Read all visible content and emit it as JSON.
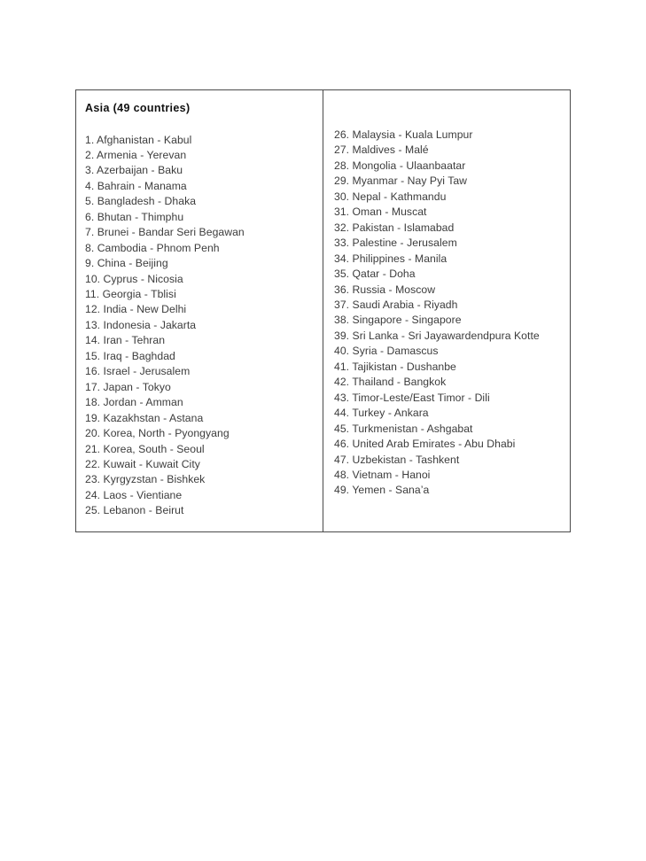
{
  "document": {
    "background_color": "#ffffff",
    "table_border_color": "#4a4a4a",
    "text_color": "#3c3c3c",
    "heading_color": "#111111"
  },
  "table": {
    "heading": "Asia (49 countries)",
    "left_column": [
      {
        "number": "1.",
        "text": "Afghanistan - Kabul"
      },
      {
        "number": "2.",
        "text": "Armenia - Yerevan"
      },
      {
        "number": "3.",
        "text": "Azerbaijan - Baku"
      },
      {
        "number": "4.",
        "text": "Bahrain - Manama"
      },
      {
        "number": "5.",
        "text": "Bangladesh - Dhaka"
      },
      {
        "number": "6.",
        "text": "Bhutan - Thimphu"
      },
      {
        "number": "7.",
        "text": "Brunei - Bandar Seri Begawan"
      },
      {
        "number": "8.",
        "text": "Cambodia - Phnom Penh"
      },
      {
        "number": "9.",
        "text": "China - Beijing"
      },
      {
        "number": "10.",
        "text": "Cyprus - Nicosia"
      },
      {
        "number": "11.",
        "text": "Georgia -  Tblisi"
      },
      {
        "number": "12.",
        "text": "India - New Delhi"
      },
      {
        "number": "13.",
        "text": "Indonesia - Jakarta"
      },
      {
        "number": "14.",
        "text": "Iran - Tehran"
      },
      {
        "number": "15.",
        "text": "Iraq - Baghdad"
      },
      {
        "number": "16.",
        "text": "Israel - Jerusalem"
      },
      {
        "number": "17.",
        "text": "Japan - Tokyo"
      },
      {
        "number": "18.",
        "text": "Jordan - Amman"
      },
      {
        "number": "19.",
        "text": "Kazakhstan - Astana"
      },
      {
        "number": "20.",
        "text": "Korea, North - Pyongyang"
      },
      {
        "number": "21.",
        "text": "Korea, South - Seoul"
      },
      {
        "number": "22.",
        "text": "Kuwait - Kuwait City"
      },
      {
        "number": "23.",
        "text": "Kyrgyzstan - Bishkek"
      },
      {
        "number": "24.",
        "text": "Laos - Vientiane"
      },
      {
        "number": "25.",
        "text": "Lebanon - Beirut"
      }
    ],
    "right_column": [
      {
        "number": "26.",
        "text": "Malaysia - Kuala Lumpur"
      },
      {
        "number": "27.",
        "text": "Maldives - Malé"
      },
      {
        "number": "28.",
        "text": "Mongolia - Ulaanbaatar"
      },
      {
        "number": "29.",
        "text": "Myanmar - Nay Pyi Taw"
      },
      {
        "number": "30.",
        "text": "Nepal - Kathmandu"
      },
      {
        "number": "31.",
        "text": "Oman - Muscat"
      },
      {
        "number": "32.",
        "text": "Pakistan - Islamabad"
      },
      {
        "number": "33.",
        "text": "Palestine - Jerusalem"
      },
      {
        "number": "34.",
        "text": "Philippines - Manila"
      },
      {
        "number": "35.",
        "text": "Qatar - Doha"
      },
      {
        "number": "36.",
        "text": "Russia - Moscow"
      },
      {
        "number": "37.",
        "text": "Saudi Arabia - Riyadh"
      },
      {
        "number": "38.",
        "text": "Singapore - Singapore"
      },
      {
        "number": "39.",
        "text": "Sri Lanka - Sri Jayawardendpura Kotte"
      },
      {
        "number": "40.",
        "text": "Syria - Damascus"
      },
      {
        "number": "41.",
        "text": "Tajikistan - Dushanbe"
      },
      {
        "number": "42.",
        "text": "Thailand - Bangkok"
      },
      {
        "number": "43.",
        "text": "Timor-Leste/East Timor - Dili"
      },
      {
        "number": "44.",
        "text": "Turkey - Ankara"
      },
      {
        "number": "45.",
        "text": "Turkmenistan - Ashgabat"
      },
      {
        "number": "46.",
        "text": "United Arab Emirates - Abu Dhabi"
      },
      {
        "number": "47.",
        "text": "Uzbekistan - Tashkent"
      },
      {
        "number": "48.",
        "text": "Vietnam - Hanoi"
      },
      {
        "number": "49.",
        "text": "Yemen - Sana’a"
      }
    ]
  }
}
